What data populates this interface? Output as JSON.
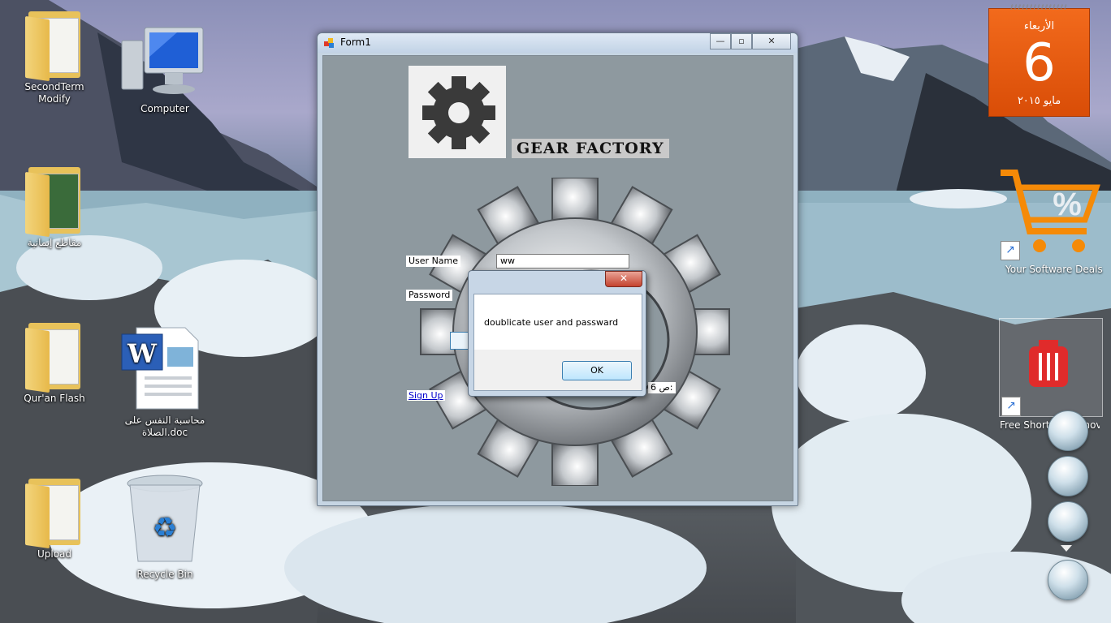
{
  "desktop": {
    "icons": [
      {
        "label": "SecondTerm Modify",
        "icon": "folder-icon"
      },
      {
        "label": "Computer",
        "icon": "computer-icon"
      },
      {
        "label": "مقاطع إيمانية",
        "icon": "folder-icon"
      },
      {
        "label": "Qur'an Flash",
        "icon": "folder-icon"
      },
      {
        "label": "محاسبة النفس على الصلاة.doc",
        "icon": "word-document-icon"
      },
      {
        "label": "Upload",
        "icon": "folder-icon"
      },
      {
        "label": "Recycle Bin",
        "icon": "recycle-bin-icon"
      }
    ],
    "shortcuts": [
      {
        "label": "Your Software Deals",
        "icon": "shopping-cart-percent-icon"
      },
      {
        "label": "Free Shortcut Remover",
        "icon": "trash-can-icon"
      }
    ],
    "calendar": {
      "weekday": "الأربعاء",
      "day": "6",
      "month_year": "مايو ٢٠١٥"
    }
  },
  "window": {
    "title": "Form1",
    "brand": "GEAR FACTORY",
    "username_label": "User Name",
    "username_value": "ww",
    "password_label": "Password",
    "signup_link": "Sign Up",
    "partial_text": "ص 6:"
  },
  "dialog": {
    "message": "doublicate user and passward",
    "ok_label": "OK",
    "close_glyph": "✕"
  },
  "colors": {
    "accent": "#f26a1c",
    "window_frame": "#c6d5e3",
    "dialog_ok": "#bee6fd"
  }
}
